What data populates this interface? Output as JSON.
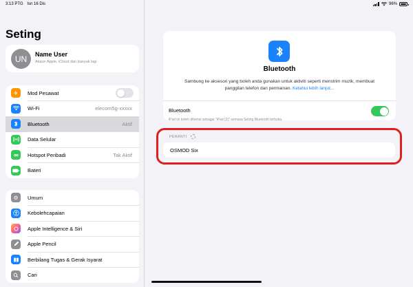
{
  "status": {
    "time": "3:13 PTG",
    "date": "Isn 16 Dis",
    "battery": "96%"
  },
  "sidebar": {
    "title": "Seting",
    "profile": {
      "initials": "UN",
      "name": "Name User",
      "subtitle": "Akaun Apple, iCloud dan banyak lagi"
    },
    "group1": [
      {
        "label": "Mod Pesawat",
        "value": "",
        "icon": "airplane-icon",
        "color": "#ff9500"
      },
      {
        "label": "Wi-Fi",
        "value": "elecom5g-xxxxx",
        "icon": "wifi-icon",
        "color": "#1a82fb"
      },
      {
        "label": "Bluetooth",
        "value": "Aktif",
        "icon": "bluetooth-icon",
        "color": "#1a82fb"
      },
      {
        "label": "Data Selular",
        "value": "",
        "icon": "cellular-icon",
        "color": "#34c759"
      },
      {
        "label": "Hotspot Peribadi",
        "value": "Tak Aktif",
        "icon": "hotspot-icon",
        "color": "#34c759"
      },
      {
        "label": "Bateri",
        "value": "",
        "icon": "battery-icon",
        "color": "#34c759"
      }
    ],
    "group2": [
      {
        "label": "Umum",
        "icon": "gear-icon",
        "color": "#8e8e93"
      },
      {
        "label": "Kebolehcapaian",
        "icon": "accessibility-icon",
        "color": "#1a82fb"
      },
      {
        "label": "Apple Intelligence & Siri",
        "icon": "siri-icon",
        "color": "#ff6b6b"
      },
      {
        "label": "Apple Pencil",
        "icon": "pencil-icon",
        "color": "#8e8e93"
      },
      {
        "label": "Berbilang Tugas & Gerak Isyarat",
        "icon": "multitask-icon",
        "color": "#1a82fb"
      },
      {
        "label": "Cari",
        "icon": "search-icon",
        "color": "#8e8e93"
      }
    ]
  },
  "main": {
    "bt_title": "Bluetooth",
    "bt_desc": "Sambung ke aksesori yang boleh anda gunakan untuk aktiviti seperti menstrim muzik, membuat panggilan telefon dan permainan.",
    "bt_link": "Ketahui lebih lanjut...",
    "bt_toggle_label": "Bluetooth",
    "bt_note": "iPad ini boleh ditemui sebagai \"iPad (2)\" semasa Seting Bluetooth terbuka.",
    "devices_header": "PERANTI",
    "device_name": "OSMOD Six",
    "accent": "#1a82fb",
    "toggle_on_color": "#34c759",
    "highlight_color": "#e01e1e"
  }
}
